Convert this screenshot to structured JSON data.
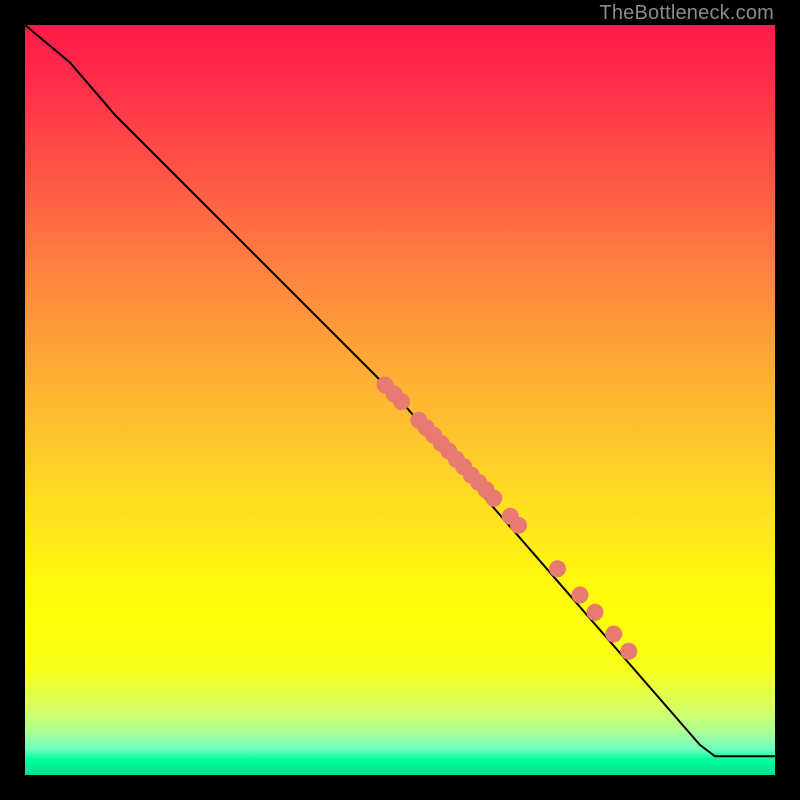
{
  "watermark": "TheBottleneck.com",
  "colors": {
    "line": "#000000",
    "point_fill": "#e87a72",
    "point_stroke": "#d86a64"
  },
  "chart_data": {
    "type": "line",
    "title": "",
    "xlabel": "",
    "ylabel": "",
    "xlim": [
      0,
      100
    ],
    "ylim": [
      0,
      100
    ],
    "grid": false,
    "line_points": [
      {
        "x": 0,
        "y": 100
      },
      {
        "x": 6,
        "y": 95
      },
      {
        "x": 12,
        "y": 88
      },
      {
        "x": 50,
        "y": 50
      },
      {
        "x": 90,
        "y": 4
      },
      {
        "x": 92,
        "y": 2.5
      },
      {
        "x": 100,
        "y": 2.5
      }
    ],
    "scatter_points": [
      {
        "x": 48.0,
        "y": 52.0
      },
      {
        "x": 49.2,
        "y": 50.8
      },
      {
        "x": 50.2,
        "y": 49.8
      },
      {
        "x": 52.5,
        "y": 47.3
      },
      {
        "x": 53.5,
        "y": 46.3
      },
      {
        "x": 54.5,
        "y": 45.3
      },
      {
        "x": 55.5,
        "y": 44.2
      },
      {
        "x": 56.5,
        "y": 43.2
      },
      {
        "x": 57.5,
        "y": 42.1
      },
      {
        "x": 58.5,
        "y": 41.1
      },
      {
        "x": 59.5,
        "y": 40.0
      },
      {
        "x": 60.5,
        "y": 39.0
      },
      {
        "x": 61.5,
        "y": 38.0
      },
      {
        "x": 62.5,
        "y": 36.9
      },
      {
        "x": 64.7,
        "y": 34.5
      },
      {
        "x": 65.8,
        "y": 33.3
      },
      {
        "x": 71.0,
        "y": 27.5
      },
      {
        "x": 74.0,
        "y": 24.0
      },
      {
        "x": 76.0,
        "y": 21.7
      },
      {
        "x": 78.5,
        "y": 18.8
      },
      {
        "x": 80.5,
        "y": 16.5
      }
    ]
  }
}
